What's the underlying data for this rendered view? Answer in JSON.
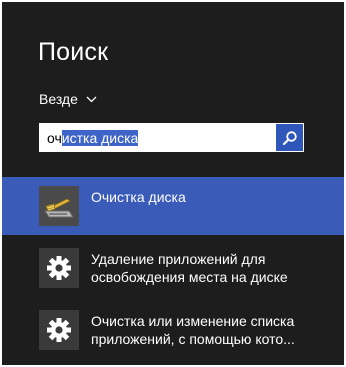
{
  "search_pane": {
    "title": "Поиск",
    "scope": {
      "label": "Везде"
    },
    "search_box": {
      "value_prefix": "оч",
      "value_selected": "истка диска"
    },
    "results": [
      {
        "lines": [
          "Очистка диска"
        ],
        "icon": "disk-cleanup-icon",
        "selected": true
      },
      {
        "lines": [
          "Удаление приложений для",
          "освобождения места на диске"
        ],
        "icon": "gear-icon",
        "selected": false
      },
      {
        "lines": [
          "Очистка или изменение списка",
          "приложений, с помощью кото..."
        ],
        "icon": "gear-icon",
        "selected": false
      }
    ],
    "colors": {
      "background": "#1d1d1d",
      "selection": "#3a5bb8",
      "search_button": "#2f56b9"
    }
  }
}
